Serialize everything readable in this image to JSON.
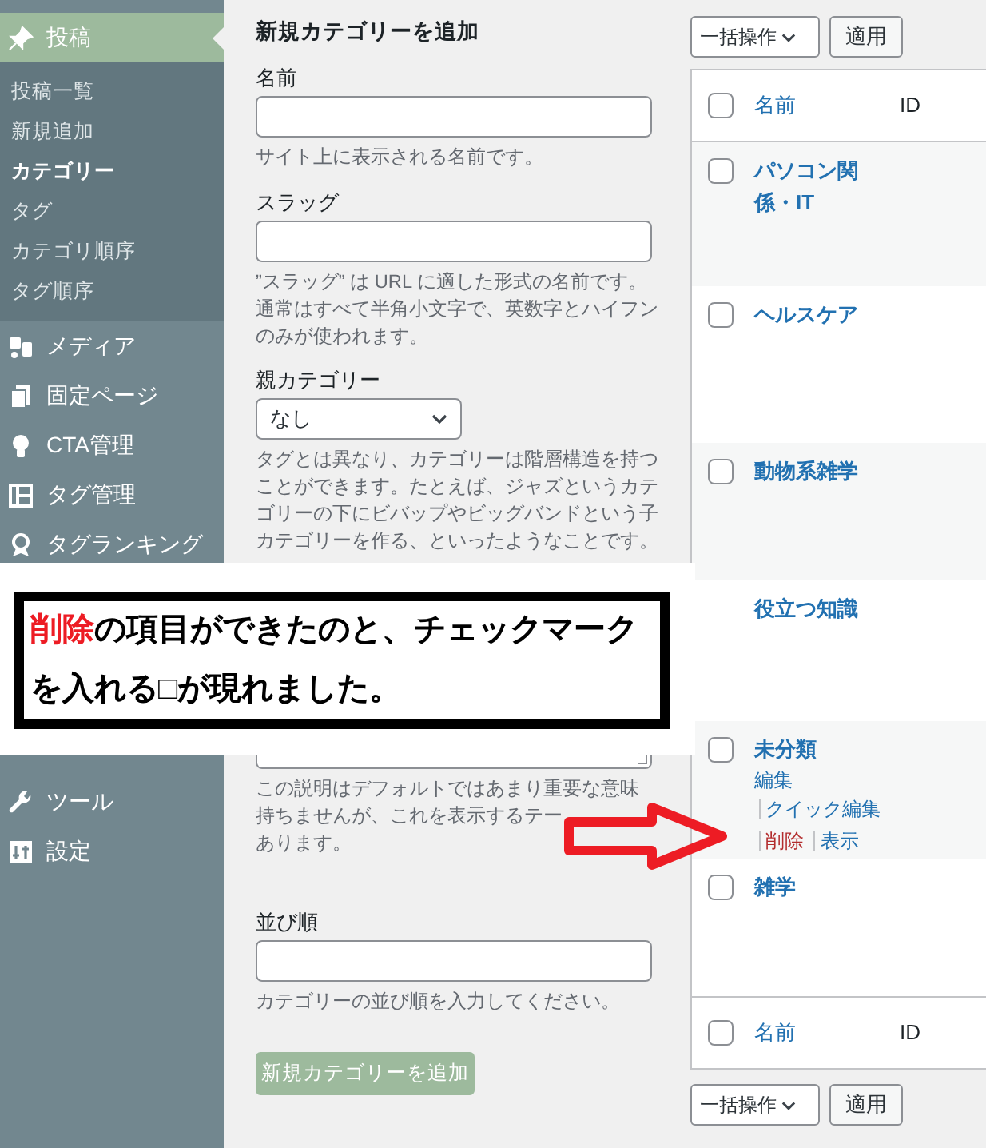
{
  "sidebar": {
    "items": [
      {
        "label": "投稿",
        "selected": true,
        "children": [
          {
            "label": "投稿一覧",
            "selected": false
          },
          {
            "label": "新規追加",
            "selected": false
          },
          {
            "label": "カテゴリー",
            "selected": true
          },
          {
            "label": "タグ",
            "selected": false
          },
          {
            "label": "カテゴリ順序",
            "selected": false
          },
          {
            "label": "タグ順序",
            "selected": false
          }
        ]
      },
      {
        "label": "メディア",
        "selected": false
      },
      {
        "label": "固定ページ",
        "selected": false
      },
      {
        "label": "CTA管理",
        "selected": false
      },
      {
        "label": "タグ管理",
        "selected": false
      },
      {
        "label": "タグランキング",
        "selected": false
      }
    ],
    "lower_items": [
      {
        "label": "ツール",
        "selected": false
      },
      {
        "label": "設定",
        "selected": false
      }
    ]
  },
  "form": {
    "title": "新規カテゴリーを追加",
    "fields": [
      {
        "kind": "text",
        "label": "名前",
        "help": [
          "サイト上に表示される名前です。"
        ]
      },
      {
        "kind": "text",
        "label": "スラッグ",
        "help": [
          "”スラッグ” は URL に適した形式の名前です。",
          "通常はすべて半角小文字で、英数字とハイフン",
          "のみが使われます。"
        ]
      },
      {
        "kind": "select",
        "label": "親カテゴリー",
        "value": "なし",
        "help": [
          "タグとは異なり、カテゴリーは階層構造を持つ",
          "ことができます。たとえば、ジャズというカテ",
          "ゴリーの下にビバップやビッグバンドという子",
          "カテゴリーを作る、といったようなことです。"
        ]
      },
      {
        "kind": "textarea",
        "help": [
          "この説明はデフォルトではあまり重要な意味",
          "持ちませんが、これを表示するテー",
          "あります。"
        ]
      },
      {
        "kind": "text",
        "label": "並び順",
        "help": [
          "カテゴリーの並び順を入力してください。"
        ]
      }
    ],
    "submit": "新規カテゴリーを追加"
  },
  "bulk_top": {
    "select": "一括操作",
    "apply": "適用"
  },
  "table": {
    "columns": [
      "名前",
      "ID"
    ],
    "select_all_checked": false,
    "rows": [
      {
        "kind": "term",
        "name": "パソコン関係・IT",
        "checked": false
      },
      {
        "kind": "term",
        "name": "ヘルスケア",
        "checked": false
      },
      {
        "kind": "term",
        "name": "動物系雑学",
        "checked": false
      },
      {
        "kind": "default",
        "name": "役立つ知識"
      },
      {
        "kind": "term",
        "name": "未分類",
        "checked": false,
        "actions": [
          {
            "label": "編集",
            "kind": "link"
          },
          {
            "label": "クイック編集",
            "kind": "link"
          },
          {
            "label": "削除",
            "kind": "delete"
          },
          {
            "label": "表示",
            "kind": "link"
          }
        ]
      },
      {
        "kind": "term",
        "name": "雑学",
        "checked": false
      }
    ],
    "footer_columns": [
      "名前",
      "ID"
    ],
    "footer_select_all_checked": false
  },
  "bulk_bottom": {
    "select": "一括操作",
    "apply": "適用"
  },
  "annotation": {
    "highlight": "削除",
    "text": "の項目ができたのと、チェックマークを入れる□が現れました。"
  }
}
